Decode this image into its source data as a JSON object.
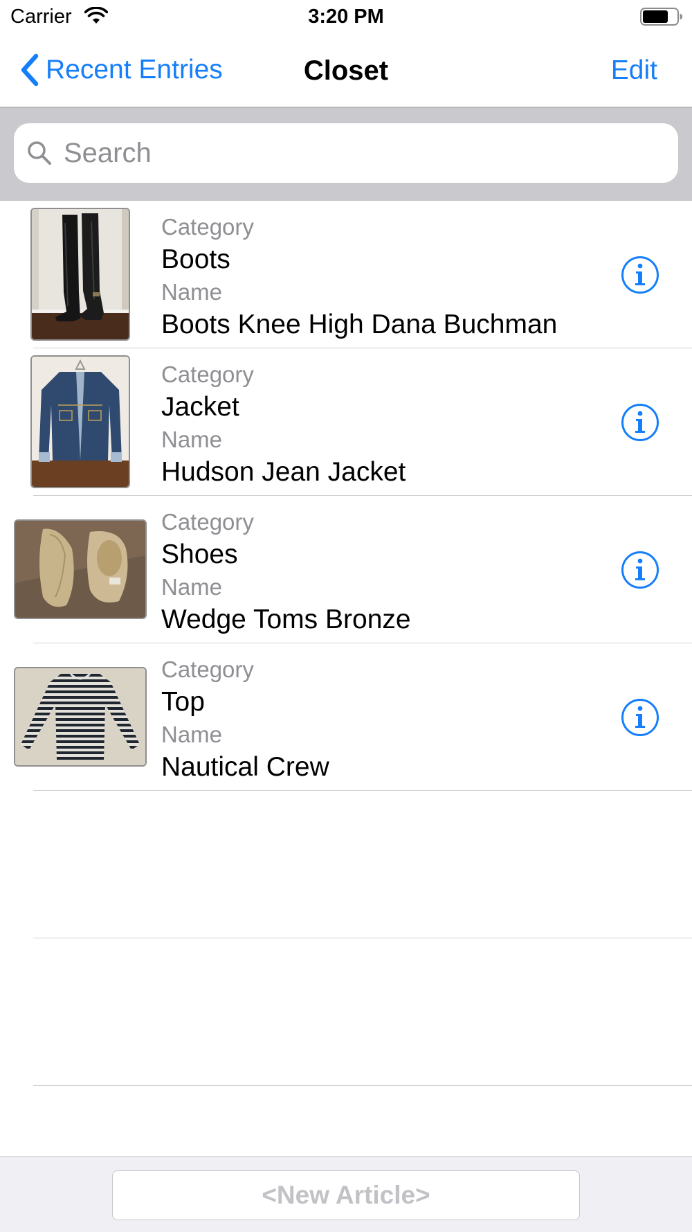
{
  "status_bar": {
    "carrier": "Carrier",
    "time": "3:20 PM"
  },
  "nav": {
    "back_label": "Recent Entries",
    "title": "Closet",
    "edit_label": "Edit"
  },
  "search": {
    "placeholder": "Search",
    "value": ""
  },
  "items": [
    {
      "category_label": "Category",
      "category": "Boots",
      "name_label": "Name",
      "name": "Boots Knee High Dana Buchman",
      "thumbnail": "boots-photo"
    },
    {
      "category_label": "Category",
      "category": "Jacket",
      "name_label": "Name",
      "name": "Hudson Jean Jacket",
      "thumbnail": "jean-jacket-photo"
    },
    {
      "category_label": "Category",
      "category": "Shoes",
      "name_label": "Name",
      "name": "Wedge Toms Bronze",
      "thumbnail": "wedge-shoes-photo"
    },
    {
      "category_label": "Category",
      "category": "Top",
      "name_label": "Name",
      "name": "Nautical Crew",
      "thumbnail": "striped-top-photo"
    }
  ],
  "toolbar": {
    "new_article_label": "<New Article>"
  },
  "colors": {
    "accent": "#157efb",
    "secondary_text": "#8e8e93",
    "search_bar_bg": "#c9c9ce",
    "toolbar_bg": "#efeff4",
    "disabled_text": "#c2c2c6"
  },
  "icons": {
    "back": "chevron-left-icon",
    "search": "magnifier-icon",
    "info": "info-circle-icon",
    "wifi": "wifi-icon",
    "battery": "battery-icon"
  }
}
